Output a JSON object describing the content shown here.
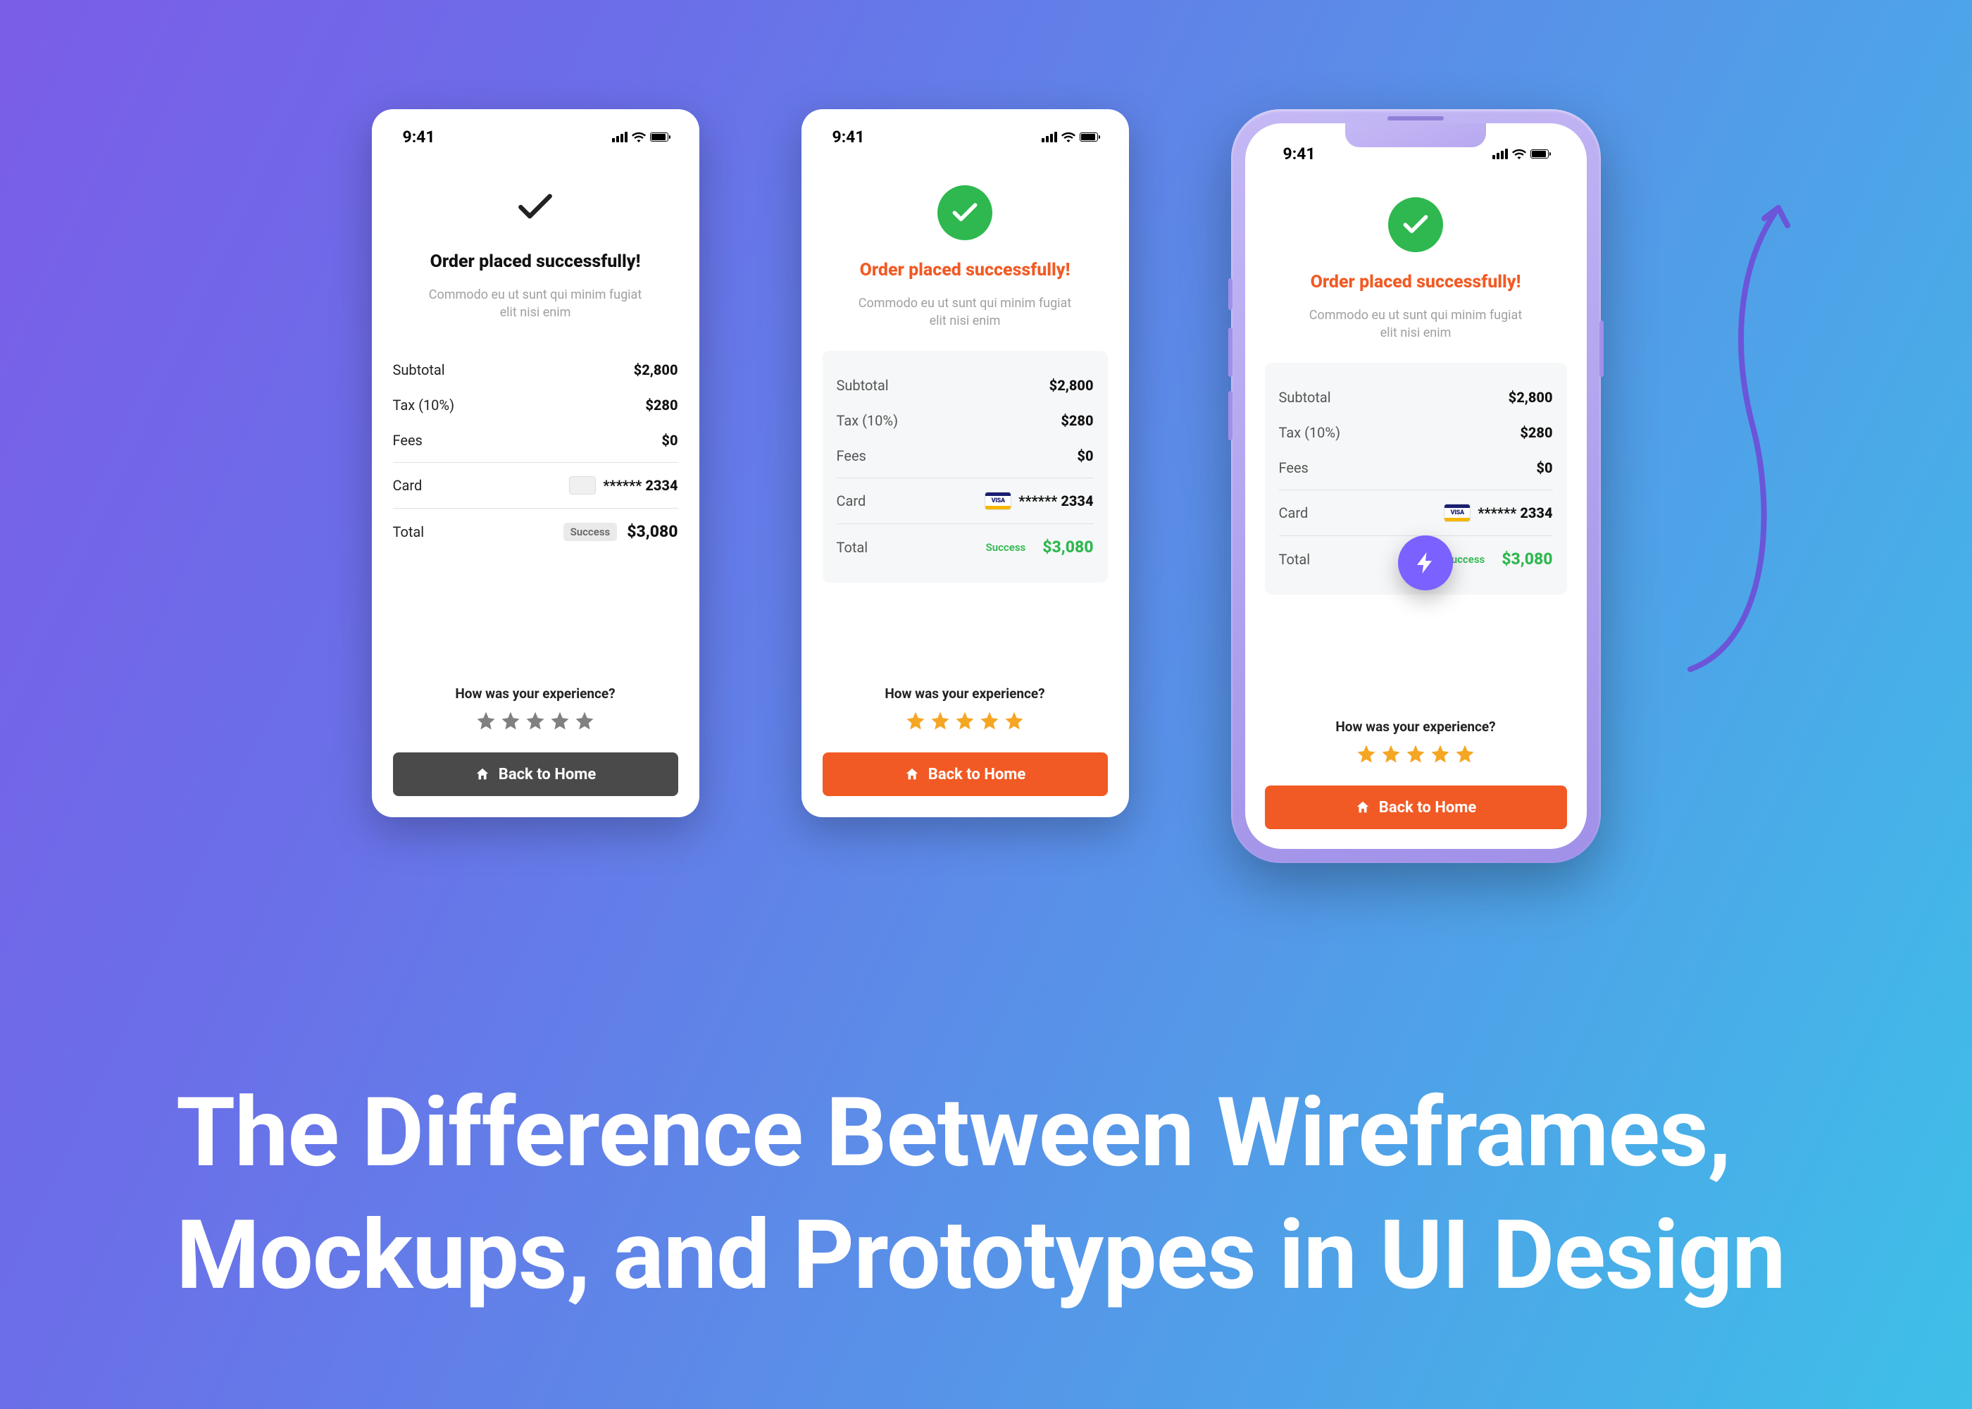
{
  "statusbar": {
    "time": "9:41"
  },
  "screen": {
    "title": "Order placed successfully!",
    "subtitle": "Commodo eu ut sunt qui minim fugiat elit nisi enim",
    "labels": {
      "subtotal": "Subtotal",
      "tax": "Tax (10%)",
      "fees": "Fees",
      "card": "Card",
      "total": "Total"
    },
    "values": {
      "subtotal": "$2,800",
      "tax": "$280",
      "fees": "$0",
      "card": "****** 2334",
      "total": "$3,080"
    },
    "badge": "Success",
    "experience": "How was your experience?",
    "button": "Back to Home",
    "card_brand": "VISA"
  },
  "headline": "The Difference Between Wireframes, Mockups, and Prototypes in UI Design"
}
